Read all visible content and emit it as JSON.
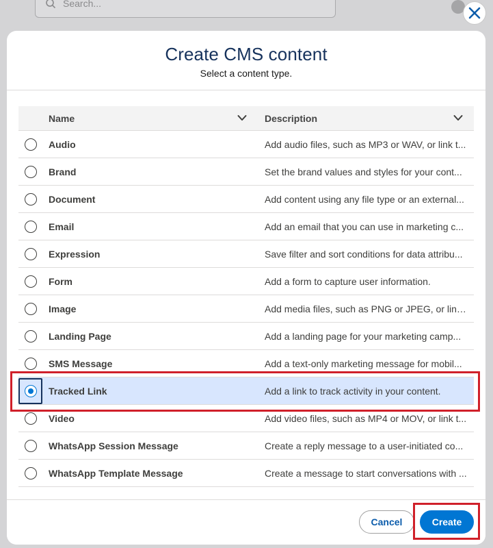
{
  "background": {
    "search_placeholder": "Search..."
  },
  "modal": {
    "title": "Create CMS content",
    "subtitle": "Select a content type.",
    "close_icon": "close-icon",
    "table": {
      "headers": {
        "name": "Name",
        "description": "Description"
      },
      "selected_index": 9,
      "rows": [
        {
          "name": "Audio",
          "description": "Add audio files, such as MP3 or WAV, or link t..."
        },
        {
          "name": "Brand",
          "description": "Set the brand values and styles for your cont..."
        },
        {
          "name": "Document",
          "description": "Add content using any file type or an external..."
        },
        {
          "name": "Email",
          "description": "Add an email that you can use in marketing c..."
        },
        {
          "name": "Expression",
          "description": "Save filter and sort conditions for data attribu..."
        },
        {
          "name": "Form",
          "description": "Add a form to capture user information."
        },
        {
          "name": "Image",
          "description": "Add media files, such as PNG or JPEG, or link ..."
        },
        {
          "name": "Landing Page",
          "description": "Add a landing page for your marketing camp..."
        },
        {
          "name": "SMS Message",
          "description": "Add a text-only marketing message for mobil..."
        },
        {
          "name": "Tracked Link",
          "description": "Add a link to track activity in your content."
        },
        {
          "name": "Video",
          "description": "Add video files, such as MP4 or MOV, or link t..."
        },
        {
          "name": "WhatsApp Session Message",
          "description": "Create a reply message to a user-initiated co..."
        },
        {
          "name": "WhatsApp Template Message",
          "description": "Create a message to start conversations with ..."
        }
      ]
    },
    "footer": {
      "cancel_label": "Cancel",
      "create_label": "Create"
    }
  },
  "colors": {
    "brand_blue": "#0176d3",
    "title_navy": "#16325c",
    "highlight_red": "#d0202a",
    "selected_row_bg": "#d8e6fe"
  }
}
